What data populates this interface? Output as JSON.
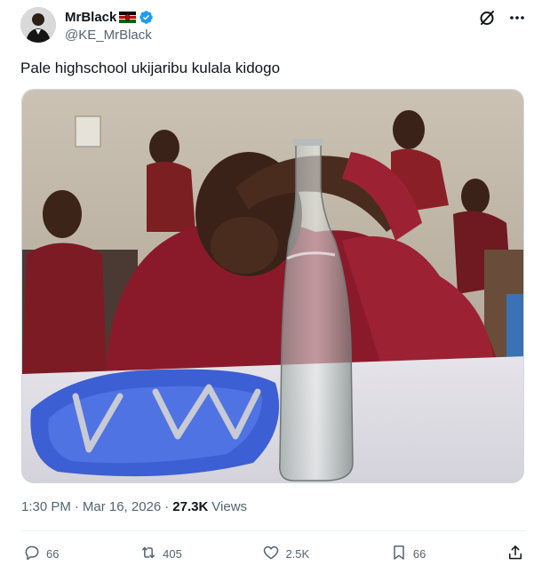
{
  "author": {
    "display_name": "MrBlack",
    "handle": "@KE_MrBlack",
    "flag_icon": "kenya-flag-icon",
    "verified_color": "#1d9bf0"
  },
  "tweet": {
    "text": "Pale highschool ukijaribu kulala kidogo",
    "time": "1:30 PM",
    "date": "Mar 16, 2026",
    "views_count": "27.3K",
    "views_label": "Views"
  },
  "actions": {
    "replies": "66",
    "reposts": "405",
    "likes": "2.5K",
    "bookmarks": "66"
  },
  "colors": {
    "text_primary": "#0f1419",
    "text_secondary": "#536471",
    "border": "#cfd9de"
  }
}
